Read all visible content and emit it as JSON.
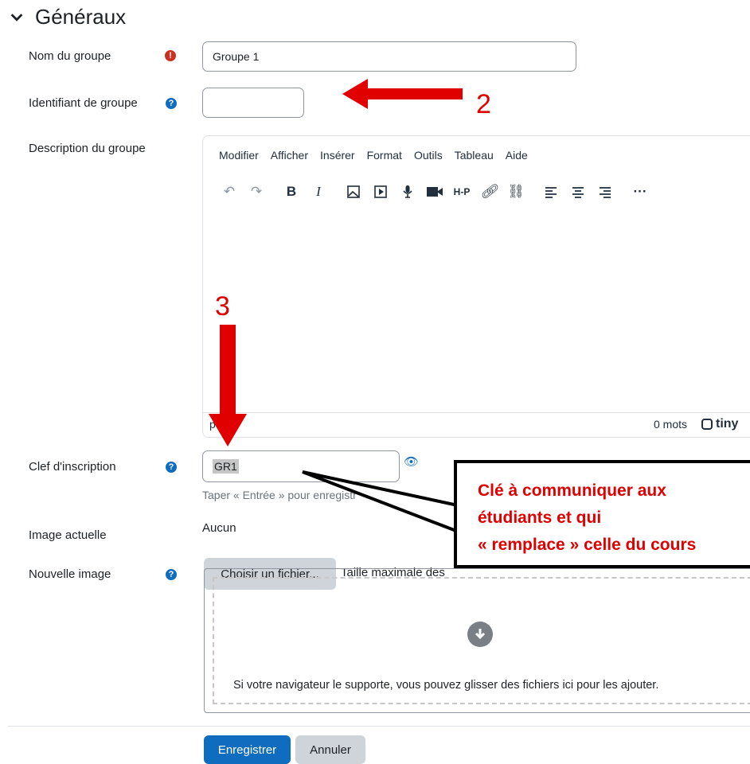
{
  "section": {
    "title": "Généraux"
  },
  "fields": {
    "group_name": {
      "label": "Nom du groupe",
      "value": "Groupe 1"
    },
    "group_id": {
      "label": "Identifiant de groupe",
      "value": ""
    },
    "description": {
      "label": "Description du groupe"
    },
    "enrol_key": {
      "label": "Clef d'inscription",
      "value": "GR1",
      "hint": "Taper « Entrée » pour enregistr"
    },
    "current_image": {
      "label": "Image actuelle",
      "value": "Aucun"
    },
    "new_image": {
      "label": "Nouvelle image",
      "choose_button": "Choisir un fichier...",
      "max_size_text": "Taille maximale des"
    }
  },
  "editor": {
    "menus": [
      "Modifier",
      "Afficher",
      "Insérer",
      "Format",
      "Outils",
      "Tableau",
      "Aide"
    ],
    "status_path": "p",
    "word_count": "0 mots",
    "brand": "tiny"
  },
  "dropzone": {
    "text": "Si votre navigateur le supporte, vous pouvez glisser des fichiers ici pour les ajouter."
  },
  "buttons": {
    "save": "Enregistrer",
    "cancel": "Annuler"
  },
  "annotations": {
    "arrow2_number": "2",
    "arrow3_number": "3",
    "callout_lines": [
      "Clé à communiquer aux",
      "étudiants et qui",
      "« remplace » celle du cours"
    ]
  },
  "colors": {
    "primary": "#0f6cbf",
    "secondary": "#ced4da",
    "required": "#ca3120",
    "annotation": "#e00000"
  }
}
